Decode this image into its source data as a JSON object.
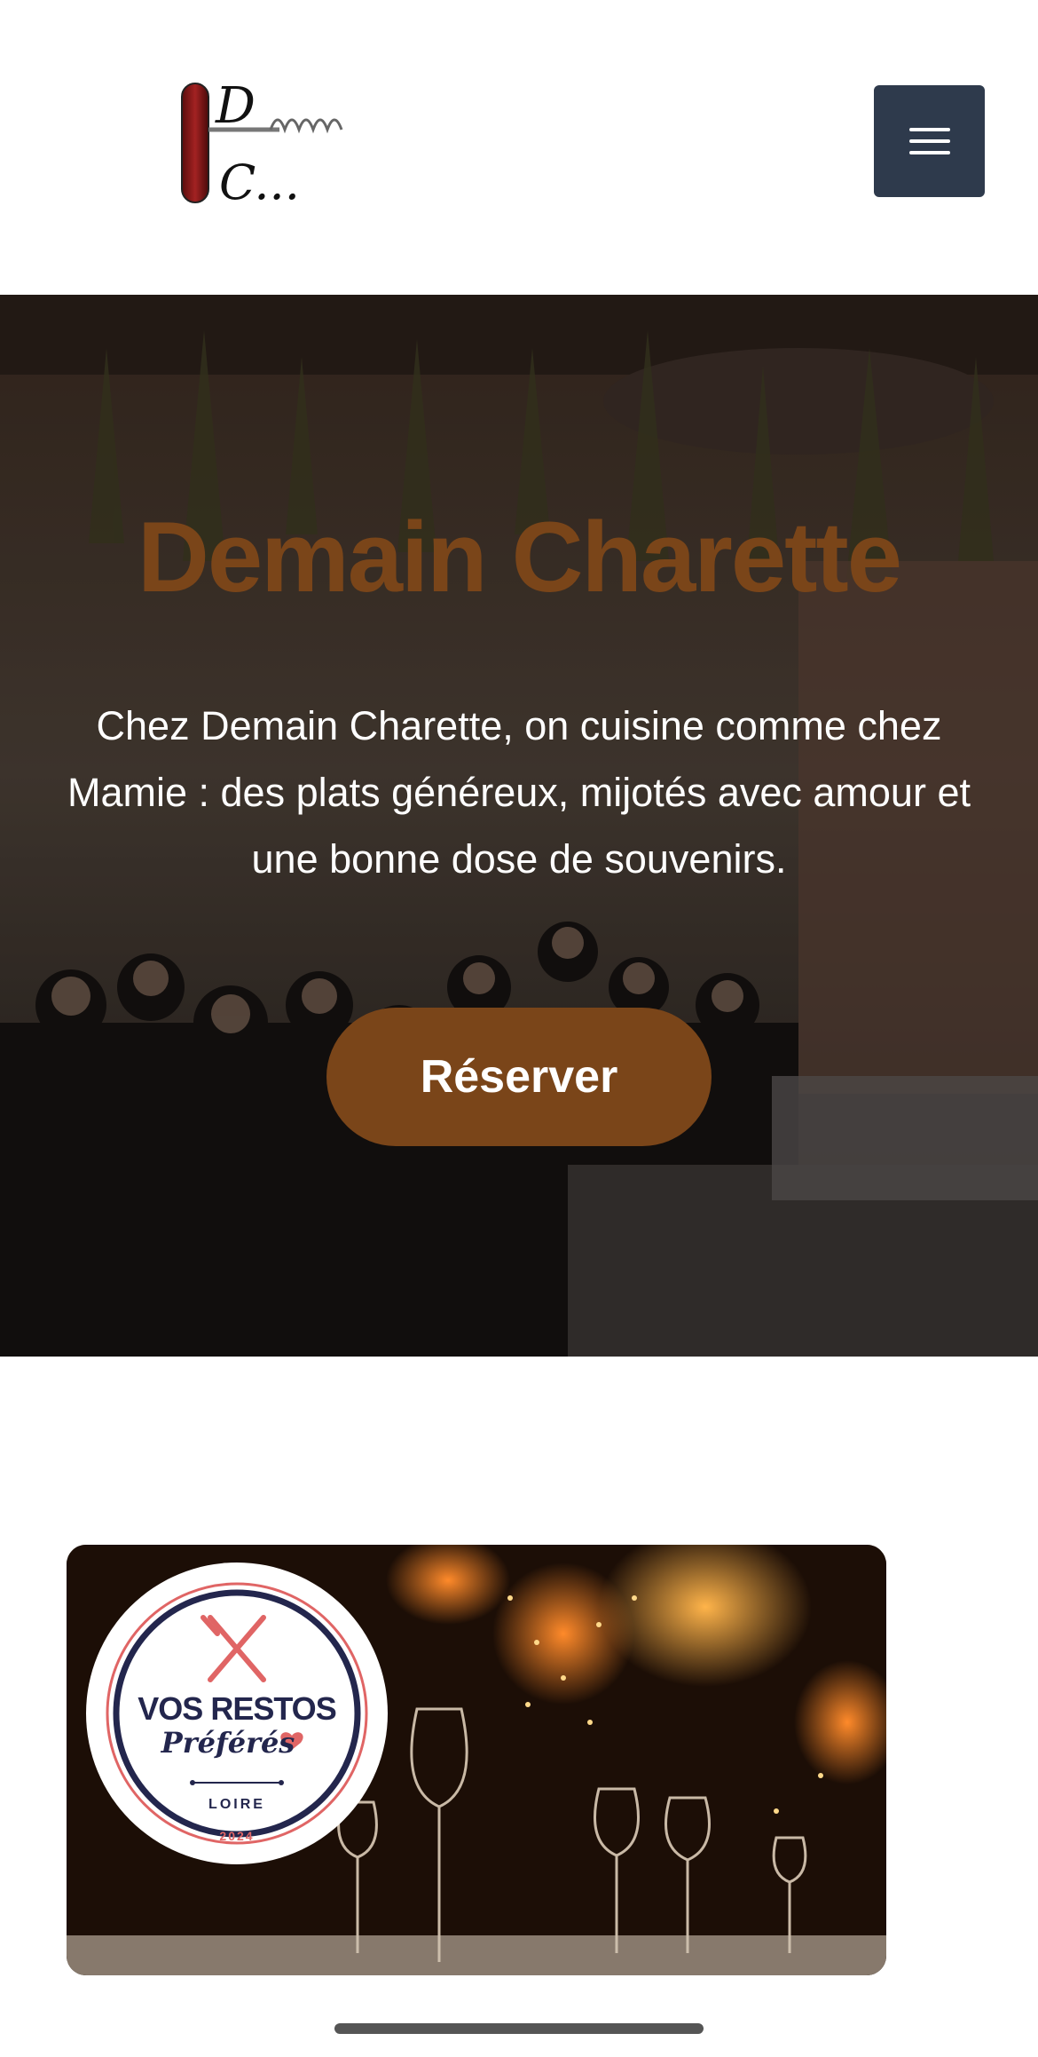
{
  "header": {
    "logo_text_d": "D",
    "logo_text_c": "C...",
    "menu_icon": "hamburger-menu-icon"
  },
  "hero": {
    "title": "Demain Charette",
    "description": "Chez Demain Charette, on cuisine comme chez Mamie : des plats généreux, mijotés avec amour et une bonne dose de souvenirs.",
    "reserve_label": "Réserver"
  },
  "promo": {
    "badge_line1": "VOS RESTOS",
    "badge_line2": "Préférés",
    "badge_region": "LOIRE",
    "badge_year": "2024"
  },
  "colors": {
    "brand_brown": "#7a4519",
    "menu_bg": "#2e3a4c",
    "badge_navy": "#23264d",
    "badge_red": "#e06565"
  }
}
